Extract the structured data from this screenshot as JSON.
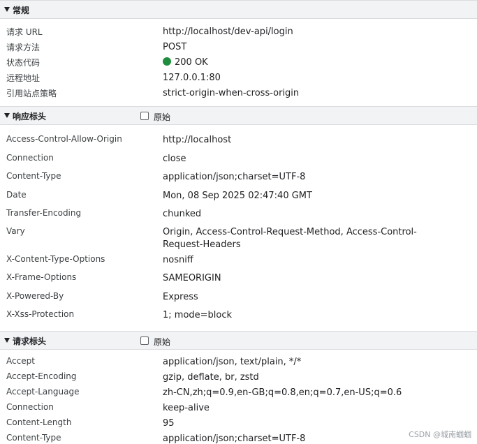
{
  "general": {
    "title": "常规",
    "request_url_key": "请求 URL",
    "request_url_value": "http://localhost/dev-api/login",
    "method_key": "请求方法",
    "method_value": "POST",
    "status_key": "状态代码",
    "status_value": "200 OK",
    "status_color": "#1e8e3e",
    "remote_key": "远程地址",
    "remote_value": "127.0.0.1:80",
    "referrer_key": "引用站点策略",
    "referrer_value": "strict-origin-when-cross-origin"
  },
  "response_headers": {
    "title": "响应标头",
    "raw_label": "原始",
    "rows": [
      {
        "key": "Access-Control-Allow-Origin",
        "value": "http://localhost"
      },
      {
        "key": "Connection",
        "value": "close"
      },
      {
        "key": "Content-Type",
        "value": "application/json;charset=UTF-8"
      },
      {
        "key": "Date",
        "value": "Mon, 08 Sep 2025 02:47:40 GMT"
      },
      {
        "key": "Transfer-Encoding",
        "value": "chunked"
      },
      {
        "key": "Vary",
        "value": "Origin, Access-Control-Request-Method, Access-Control-Request-Headers"
      },
      {
        "key": "X-Content-Type-Options",
        "value": "nosniff"
      },
      {
        "key": "X-Frame-Options",
        "value": "SAMEORIGIN"
      },
      {
        "key": "X-Powered-By",
        "value": "Express"
      },
      {
        "key": "X-Xss-Protection",
        "value": "1; mode=block"
      }
    ]
  },
  "request_headers": {
    "title": "请求标头",
    "raw_label": "原始",
    "rows": [
      {
        "key": "Accept",
        "value": "application/json, text/plain, */*"
      },
      {
        "key": "Accept-Encoding",
        "value": "gzip, deflate, br, zstd"
      },
      {
        "key": "Accept-Language",
        "value": "zh-CN,zh;q=0.9,en-GB;q=0.8,en;q=0.7,en-US;q=0.6"
      },
      {
        "key": "Connection",
        "value": "keep-alive"
      },
      {
        "key": "Content-Length",
        "value": "95"
      },
      {
        "key": "Content-Type",
        "value": "application/json;charset=UTF-8"
      }
    ]
  },
  "watermark": "CSDN @城南蝈蝈"
}
